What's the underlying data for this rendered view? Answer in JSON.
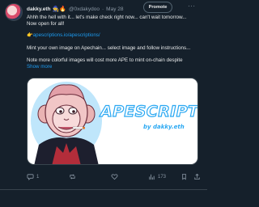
{
  "tweet": {
    "author_name": "dakky.eth",
    "author_badges": "🧙🔥",
    "handle": "@0xdakydoo",
    "date": "May 28",
    "promote_label": "Promote",
    "more_icon": "ellipsis-icon",
    "text_lines": [
      "Ahhh the hell with it... let's make check right now... can't wait tomorrow...",
      "Now open for all!"
    ],
    "link_prefix": "👉",
    "link_text": "apescriptions.io/apescriptions/",
    "body_line_1": "Mint your own image on Apechain... select image and follow instructions...",
    "body_line_2": "Note more colorful images will cost more APE to mint on-chain despite",
    "show_more": "Show more",
    "media": {
      "title": "APESCRIPTIONS",
      "subtitle": "by dakky.eth"
    },
    "stats": {
      "replies": "1",
      "reposts": "",
      "likes": "",
      "views": "173"
    }
  },
  "colors": {
    "background": "#15202b",
    "text": "#e7e9ea",
    "muted": "#8b98a5",
    "link": "#1d9bf0",
    "accent": "#2aa8f2"
  }
}
